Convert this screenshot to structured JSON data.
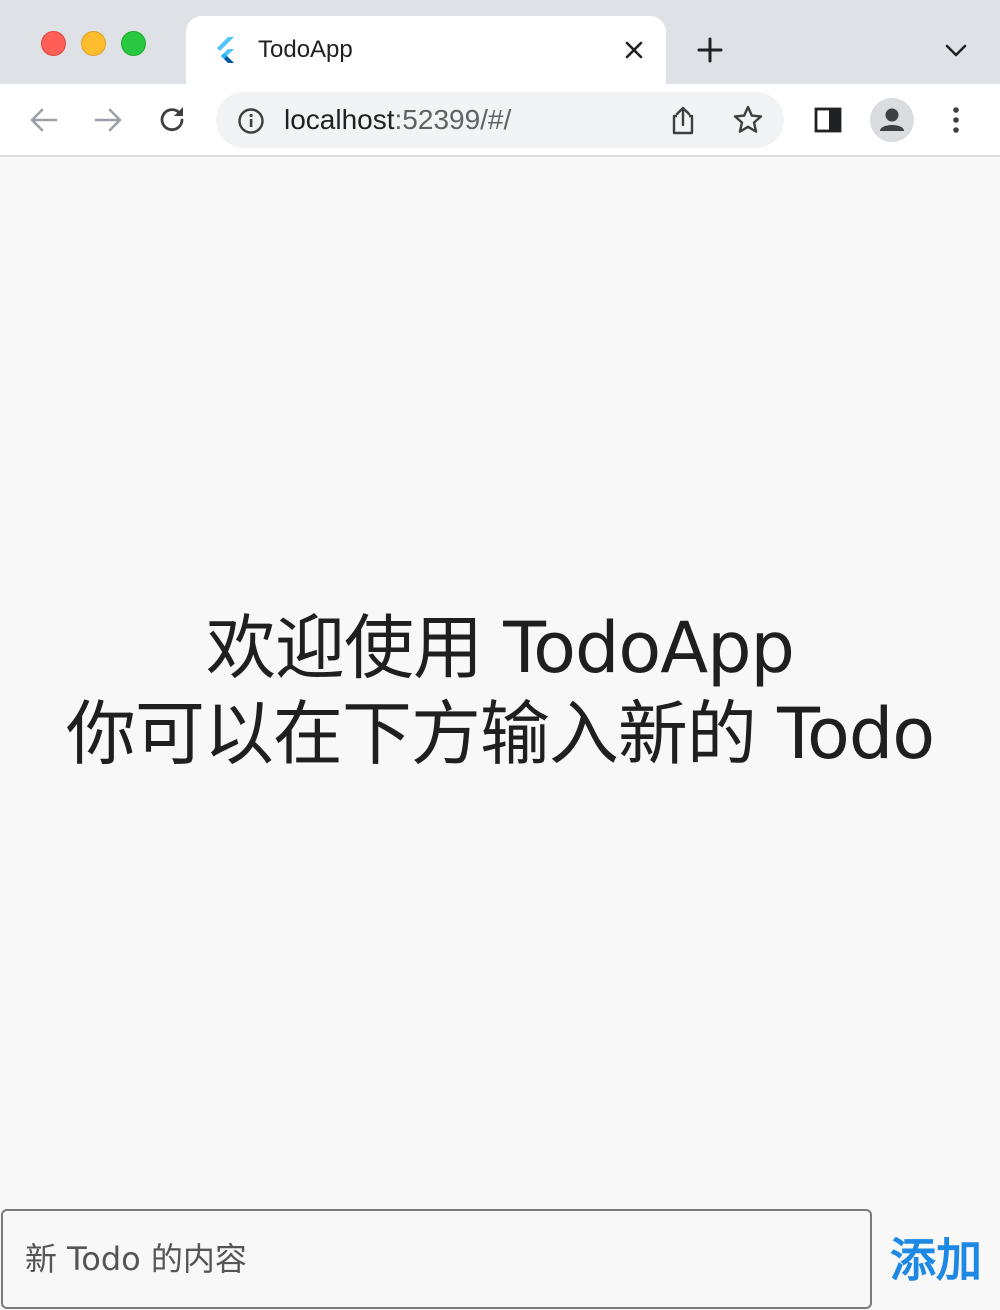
{
  "browser": {
    "tab": {
      "title": "TodoApp",
      "favicon": "flutter-logo-icon"
    },
    "address": {
      "host": "localhost",
      "rest": ":52399/#/"
    },
    "colors": {
      "tabstrip": "#dee1e6",
      "toolbar": "#ffffff",
      "omnibox": "#f1f3f4"
    }
  },
  "app": {
    "welcome_line1": "欢迎使用 TodoApp",
    "welcome_line2": "你可以在下方输入新的 Todo",
    "input": {
      "placeholder": "新 Todo 的内容",
      "value": ""
    },
    "add_label": "添加",
    "colors": {
      "background": "#f8f8f8",
      "accent": "#1e88e5",
      "text": "#1f1f1f"
    }
  }
}
